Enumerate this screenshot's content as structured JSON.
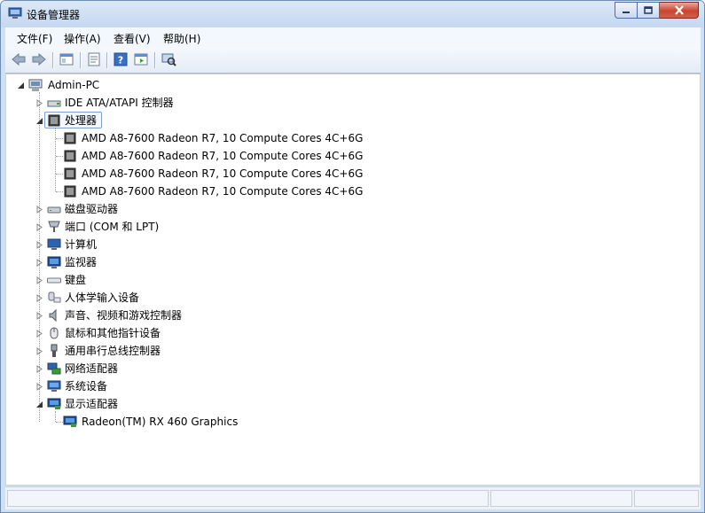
{
  "window": {
    "title": "设备管理器"
  },
  "menu": {
    "file": "文件(F)",
    "action": "操作(A)",
    "view": "查看(V)",
    "help": "帮助(H)"
  },
  "toolbar": {
    "icons": [
      "back-arrow-icon",
      "forward-arrow-icon",
      "show-hide-tree-icon",
      "properties-icon",
      "help-icon",
      "console-view-icon",
      "scan-hardware-icon"
    ]
  },
  "tree": {
    "root": "Admin-PC",
    "ide": "IDE ATA/ATAPI 控制器",
    "processors": "处理器",
    "cpu_items": [
      "AMD A8-7600 Radeon R7, 10 Compute Cores 4C+6G",
      "AMD A8-7600 Radeon R7, 10 Compute Cores 4C+6G",
      "AMD A8-7600 Radeon R7, 10 Compute Cores 4C+6G",
      "AMD A8-7600 Radeon R7, 10 Compute Cores 4C+6G"
    ],
    "disk": "磁盘驱动器",
    "ports": "端口 (COM 和 LPT)",
    "computer": "计算机",
    "monitor": "监视器",
    "keyboard": "键盘",
    "hid": "人体学输入设备",
    "sound": "声音、视频和游戏控制器",
    "mouse": "鼠标和其他指针设备",
    "usb": "通用串行总线控制器",
    "network": "网络适配器",
    "system": "系统设备",
    "display": "显示适配器",
    "gpu": "Radeon(TM) RX 460 Graphics"
  },
  "colors": {
    "selection_border": "#7da2ce",
    "title_bg": "#c5d8ef",
    "close_red": "#c9452f"
  }
}
